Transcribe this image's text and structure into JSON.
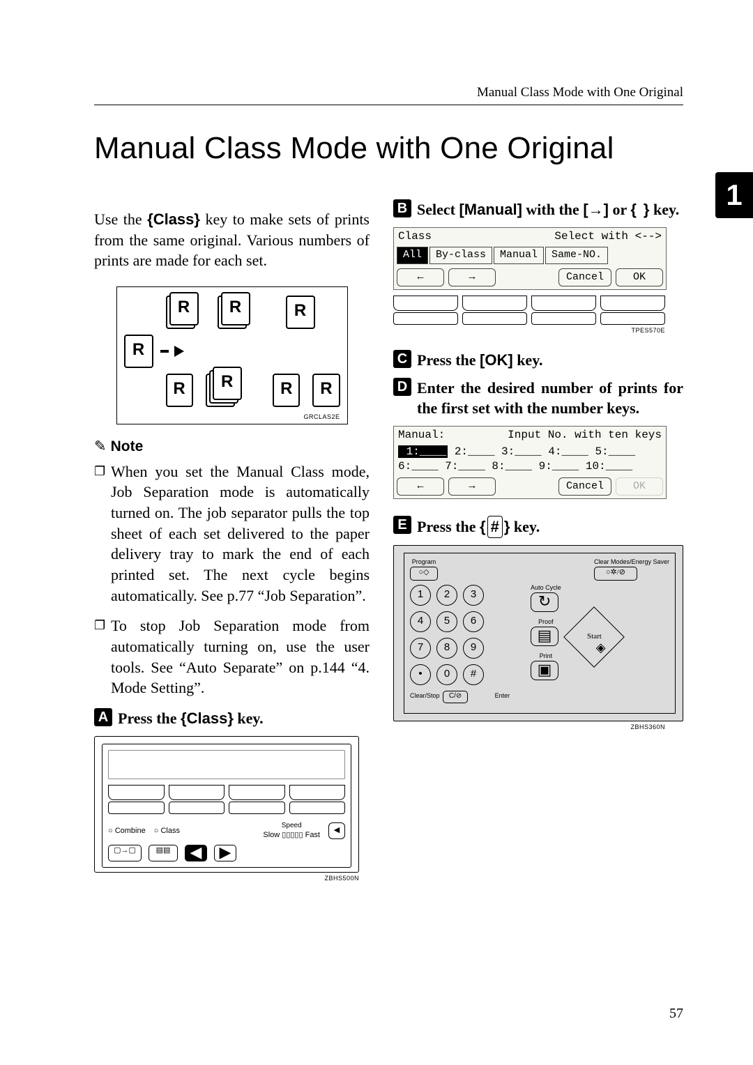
{
  "running_head": "Manual Class Mode with One Original",
  "title": "Manual Class Mode with One Original",
  "intro_a": "Use the ",
  "intro_key": "{Class}",
  "intro_b": " key to make sets of prints from the same original. Various numbers of prints are made for each set.",
  "illus1_id": "GRCLAS2E",
  "note_heading": "Note",
  "note_items": [
    "When you set the Manual Class mode, Job Separation mode is automatically turned on. The job separator pulls the top sheet of each set delivered to the paper delivery tray to mark the end of each printed set. The next cycle begins automatically. See p.77 “Job Separation”.",
    "To stop Job Separation mode from automatically turning on, use the user tools. See “Auto Separate” on p.144 “4. Mode Setting”."
  ],
  "step1_a": "Press the ",
  "step1_key": "{Class}",
  "step1_b": " key.",
  "panel1_id": "ZBHS500N",
  "panel1": {
    "combine": "Combine",
    "class": "Class",
    "speed": "Speed",
    "slow": "Slow",
    "fast": "Fast"
  },
  "step2_a": "Select ",
  "step2_key1": "[Manual]",
  "step2_b": " with the ",
  "step2_key2": "[→]",
  "step2_c": " or ",
  "step2_key3": "{}",
  "step2_d": " key.",
  "disp1": {
    "title": "Class",
    "hint": "Select with <-->",
    "tabs": [
      "All",
      "By-class",
      "Manual",
      "Same-NO."
    ],
    "soft": [
      "←",
      "→",
      "Cancel",
      "OK"
    ]
  },
  "disp1_id": "TPES570E",
  "step3": "Press the [OK] key.",
  "step4": "Enter the desired number of prints for the first set with the number keys.",
  "disp2": {
    "title": "Manual:",
    "hint": "Input No. with ten keys",
    "line1": " 1:____  2:____  3:____  4:____  5:____",
    "line2": " 6:____  7:____  8:____  9:____ 10:____",
    "soft": [
      "←",
      "→",
      "Cancel",
      "OK"
    ]
  },
  "step5_a": "Press the ",
  "step5_key": "#",
  "step5_b": " key.",
  "kp": {
    "program": "Program",
    "clearmodes": "Clear Modes/Energy Saver",
    "auto": "Auto Cycle",
    "proof": "Proof",
    "print": "Print",
    "enter": "Enter",
    "start": "Start",
    "clearstop": "Clear/Stop",
    "keys": [
      "1",
      "2",
      "3",
      "4",
      "5",
      "6",
      "7",
      "8",
      "9",
      "•",
      "0",
      "#"
    ]
  },
  "kp_id": "ZBHS360N",
  "chapter_tab": "1",
  "page_number": "57"
}
